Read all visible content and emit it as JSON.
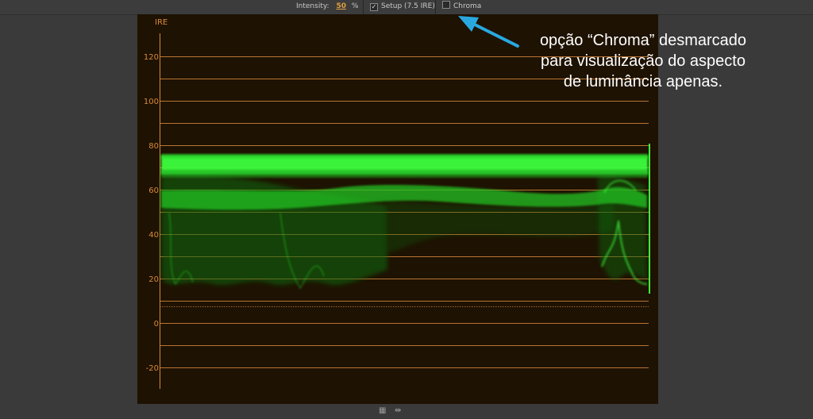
{
  "toolbar": {
    "intensity_label": "Intensity:",
    "intensity_value": "50",
    "intensity_unit": "%",
    "setup_label": "Setup (7.5 IRE)",
    "setup_checked": true,
    "chroma_label": "Chroma",
    "chroma_checked": false
  },
  "scope": {
    "unit_label": "IRE",
    "axis_labels": [
      "120",
      "100",
      "80",
      "60",
      "40",
      "20",
      "0",
      "-20"
    ],
    "accent_color": "#d98a3a",
    "trace_color": "#33ff33",
    "background_color": "#1e1202"
  },
  "annotation": {
    "line1": "opção “Chroma” desmarcado",
    "line2": "para visualização do aspecto",
    "line3": "de luminância apenas.",
    "arrow_color": "#29a8e0"
  },
  "footer": {
    "icons": [
      "film-strip-icon",
      "scroll-arrows-icon"
    ]
  }
}
